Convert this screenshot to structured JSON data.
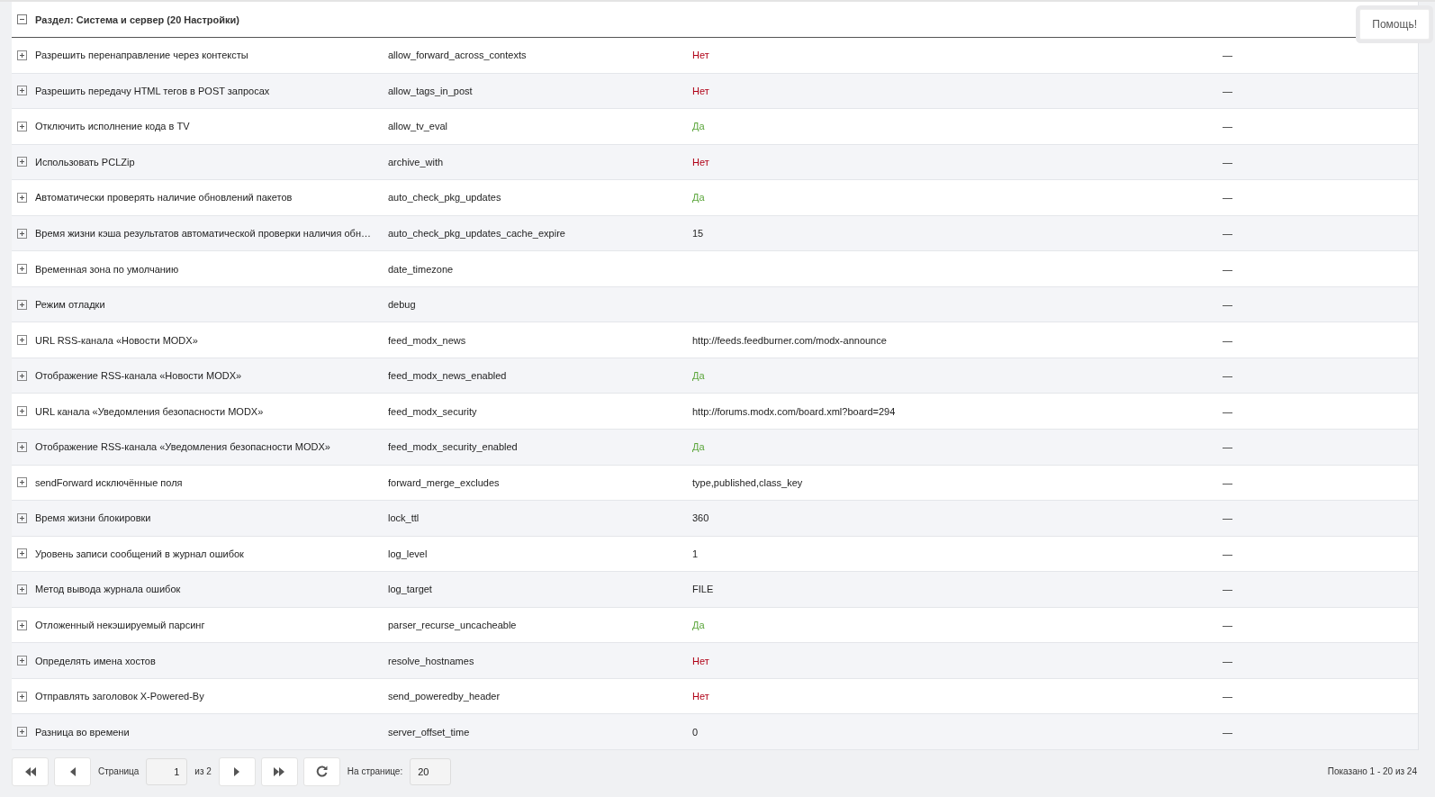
{
  "section": {
    "title": "Раздел: Система и сервер (20 Настройки)",
    "expanded": true
  },
  "help_button": "Помощь!",
  "rows": [
    {
      "name": "Разрешить перенаправление через контексты",
      "key": "allow_forward_across_contexts",
      "value": "Нет",
      "kind": "no",
      "extra": "—"
    },
    {
      "name": "Разрешить передачу HTML тегов в POST запросах",
      "key": "allow_tags_in_post",
      "value": "Нет",
      "kind": "no",
      "extra": "—"
    },
    {
      "name": "Отключить исполнение кода в TV",
      "key": "allow_tv_eval",
      "value": "Да",
      "kind": "yes",
      "extra": "—"
    },
    {
      "name": "Использовать PCLZip",
      "key": "archive_with",
      "value": "Нет",
      "kind": "no",
      "extra": "—"
    },
    {
      "name": "Автоматически проверять наличие обновлений пакетов",
      "key": "auto_check_pkg_updates",
      "value": "Да",
      "kind": "yes",
      "extra": "—"
    },
    {
      "name": "Время жизни кэша результатов автоматической проверки наличия обн…",
      "key": "auto_check_pkg_updates_cache_expire",
      "value": "15",
      "kind": "text",
      "extra": "—"
    },
    {
      "name": "Временная зона по умолчанию",
      "key": "date_timezone",
      "extra": "—"
    },
    {
      "name": "Режим отладки",
      "key": "debug",
      "extra": "—"
    },
    {
      "name": "URL RSS-канала «Новости MODX»",
      "key": "feed_modx_news",
      "value": "http://feeds.feedburner.com/modx-announce",
      "kind": "text",
      "extra": "—"
    },
    {
      "name": "Отображение RSS-канала «Новости MODX»",
      "key": "feed_modx_news_enabled",
      "value": "Да",
      "kind": "yes",
      "extra": "—"
    },
    {
      "name": "URL канала «Уведомления безопасности MODX»",
      "key": "feed_modx_security",
      "value": "http://forums.modx.com/board.xml?board=294",
      "kind": "text",
      "extra": "—"
    },
    {
      "name": "Отображение RSS-канала «Уведомления безопасности MODX»",
      "key": "feed_modx_security_enabled",
      "value": "Да",
      "kind": "yes",
      "extra": "—"
    },
    {
      "name": "sendForward исключённые поля",
      "key": "forward_merge_excludes",
      "value": "type,published,class_key",
      "kind": "text",
      "extra": "—"
    },
    {
      "name": "Время жизни блокировки",
      "key": "lock_ttl",
      "value": "360",
      "kind": "text",
      "extra": "—"
    },
    {
      "name": "Уровень записи сообщений в журнал ошибок",
      "key": "log_level",
      "value": "1",
      "kind": "text",
      "extra": "—"
    },
    {
      "name": "Метод вывода журнала ошибок",
      "key": "log_target",
      "value": "FILE",
      "kind": "text",
      "extra": "—"
    },
    {
      "name": "Отложенный некэшируемый парсинг",
      "key": "parser_recurse_uncacheable",
      "value": "Да",
      "kind": "yes",
      "extra": "—"
    },
    {
      "name": "Определять имена хостов",
      "key": "resolve_hostnames",
      "value": "Нет",
      "kind": "no",
      "extra": "—"
    },
    {
      "name": "Отправлять заголовок X-Powered-By",
      "key": "send_poweredby_header",
      "value": "Нет",
      "kind": "no",
      "extra": "—"
    },
    {
      "name": "Разница во времени",
      "key": "server_offset_time",
      "value": "0",
      "kind": "text",
      "extra": "—"
    }
  ],
  "pager": {
    "page_label": "Страница",
    "page": "1",
    "of": "из 2",
    "per_page_label": "На странице:",
    "per_page": "20",
    "summary": "Показано 1 - 20 из 24"
  }
}
